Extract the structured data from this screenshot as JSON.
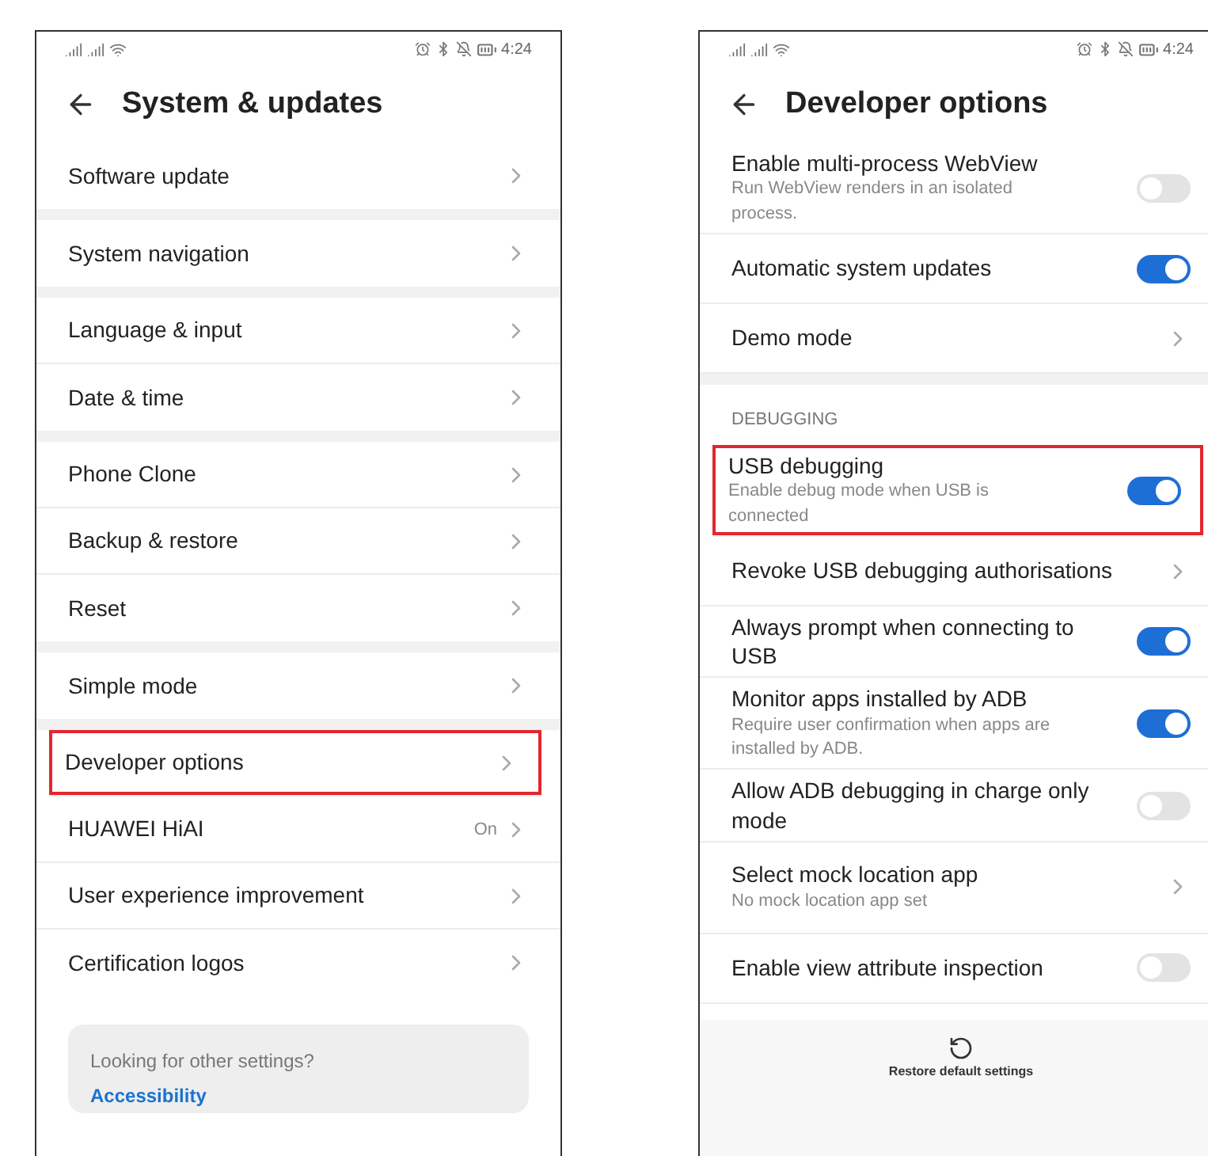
{
  "left_screen": {
    "status_time": "4:24",
    "title": "System & updates",
    "groups": [
      {
        "items": [
          {
            "label": "Software update",
            "highlighted": false
          }
        ]
      },
      {
        "items": [
          {
            "label": "System navigation",
            "highlighted": false
          }
        ]
      },
      {
        "items": [
          {
            "label": "Language & input",
            "highlighted": false
          },
          {
            "label": "Date & time",
            "highlighted": false
          }
        ]
      },
      {
        "items": [
          {
            "label": "Phone Clone",
            "highlighted": false
          },
          {
            "label": "Backup & restore",
            "highlighted": false
          },
          {
            "label": "Reset",
            "highlighted": false
          }
        ]
      },
      {
        "items": [
          {
            "label": "Simple mode",
            "highlighted": false
          }
        ]
      },
      {
        "items": [
          {
            "label": "Developer options",
            "highlighted": true
          },
          {
            "label": "HUAWEI HiAI",
            "value": "On",
            "highlighted": false
          },
          {
            "label": "User experience improvement",
            "highlighted": false
          },
          {
            "label": "Certification logos",
            "highlighted": false
          }
        ]
      }
    ],
    "suggestion": {
      "prompt": "Looking for other settings?",
      "link": "Accessibility"
    }
  },
  "right_screen": {
    "status_time": "4:24",
    "title": "Developer options",
    "sections": [
      {
        "items": [
          {
            "kind": "toggle",
            "title": "Enable multi-process WebView",
            "subtitle": "Run WebView renders in an isolated process.",
            "on": false,
            "highlighted": false
          },
          {
            "kind": "toggle",
            "title": "Automatic system updates",
            "on": true,
            "highlighted": false
          },
          {
            "kind": "link",
            "title": "Demo mode",
            "highlighted": false
          }
        ]
      },
      {
        "header": "DEBUGGING",
        "items": [
          {
            "kind": "toggle",
            "title": "USB debugging",
            "subtitle": "Enable debug mode when USB is connected",
            "on": true,
            "highlighted": true
          },
          {
            "kind": "link",
            "title": "Revoke USB debugging authorisations",
            "highlighted": false
          },
          {
            "kind": "toggle",
            "title": "Always prompt when connecting to USB",
            "on": true,
            "highlighted": false
          },
          {
            "kind": "toggle",
            "title": "Monitor apps installed by ADB",
            "subtitle": "Require user confirmation when apps are installed by ADB.",
            "on": true,
            "highlighted": false
          },
          {
            "kind": "toggle",
            "title": "Allow ADB debugging in charge only mode",
            "on": false,
            "highlighted": false
          },
          {
            "kind": "link",
            "title": "Select mock location app",
            "subtitle": "No mock location app set",
            "highlighted": false
          },
          {
            "kind": "toggle",
            "title": "Enable view attribute inspection",
            "on": false,
            "highlighted": false
          }
        ]
      }
    ],
    "footer": {
      "label": "Restore default settings"
    }
  }
}
